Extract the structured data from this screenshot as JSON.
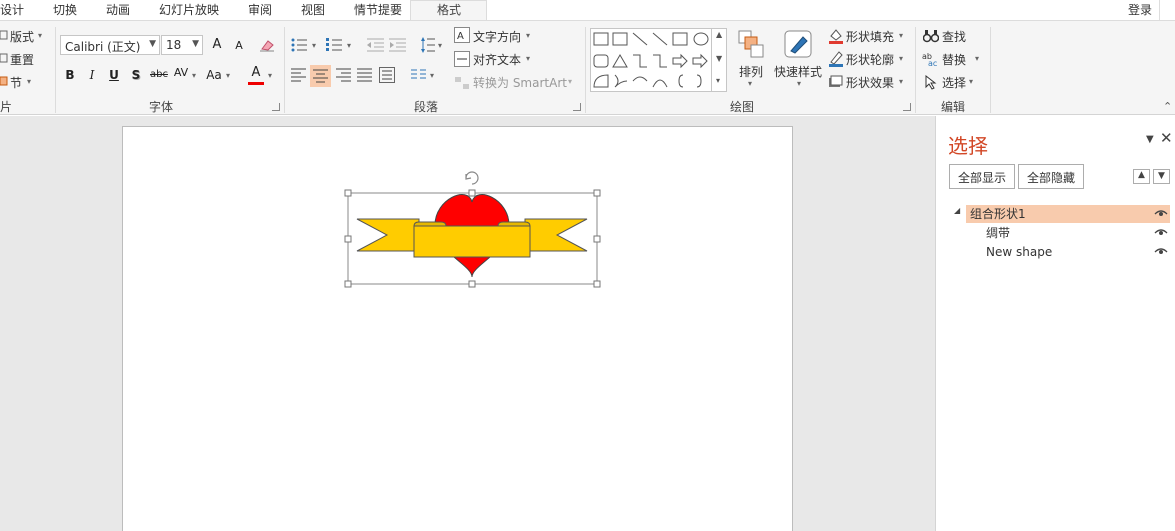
{
  "tabs": [
    {
      "label": "设计"
    },
    {
      "label": "切换"
    },
    {
      "label": "动画"
    },
    {
      "label": "幻灯片放映"
    },
    {
      "label": "审阅"
    },
    {
      "label": "视图"
    },
    {
      "label": "情节提要"
    },
    {
      "label": "格式"
    }
  ],
  "account": {
    "login_label": "登录"
  },
  "ribbon": {
    "slides": {
      "label": "片",
      "layout": "版式",
      "reset": "重置",
      "section": "节"
    },
    "font": {
      "label": "字体",
      "font_name": "Calibri (正文)",
      "font_size": "18",
      "grow": "A",
      "shrink": "A",
      "bold": "B",
      "italic": "I",
      "underline": "U",
      "shadow": "S",
      "strike": "abc",
      "spacing": "AV",
      "case": "Aa",
      "color": "A"
    },
    "paragraph": {
      "label": "段落",
      "text_direction": "文字方向",
      "align_text": "对齐文本",
      "convert_smartart": "转换为 SmartArt"
    },
    "drawing": {
      "label": "绘图",
      "arrange": "排列",
      "quick_styles": "快速样式",
      "shape_fill": "形状填充",
      "shape_outline": "形状轮廓",
      "shape_effects": "形状效果",
      "fill_color": "#e03a2f",
      "outline_color": "#2e75b6"
    },
    "editing": {
      "label": "编辑",
      "find": "查找",
      "replace": "替换",
      "select": "选择"
    }
  },
  "selection_pane": {
    "title": "选择",
    "show_all": "全部显示",
    "hide_all": "全部隐藏",
    "items": [
      {
        "label": "组合形状1",
        "selected": true
      },
      {
        "label": "绸带",
        "selected": false
      },
      {
        "label": "New shape",
        "selected": false
      }
    ]
  },
  "slide_shape": {
    "heart_color": "#ff0000",
    "ribbon_color": "#ffcc00"
  }
}
